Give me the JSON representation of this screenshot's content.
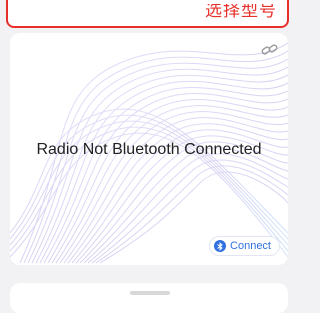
{
  "header": {
    "model_select_label": "选择型号"
  },
  "device_card": {
    "status_text": "Radio Not Bluetooth Connected",
    "connect_button_label": "Connect",
    "link_icon": "link-icon",
    "bluetooth_icon": "bluetooth-icon"
  },
  "colors": {
    "accent_red": "#e8302a",
    "connect_blue": "#2f6fe0",
    "wave_lavender": "#d9d2f3",
    "wave_blue": "#cfe3fb"
  }
}
